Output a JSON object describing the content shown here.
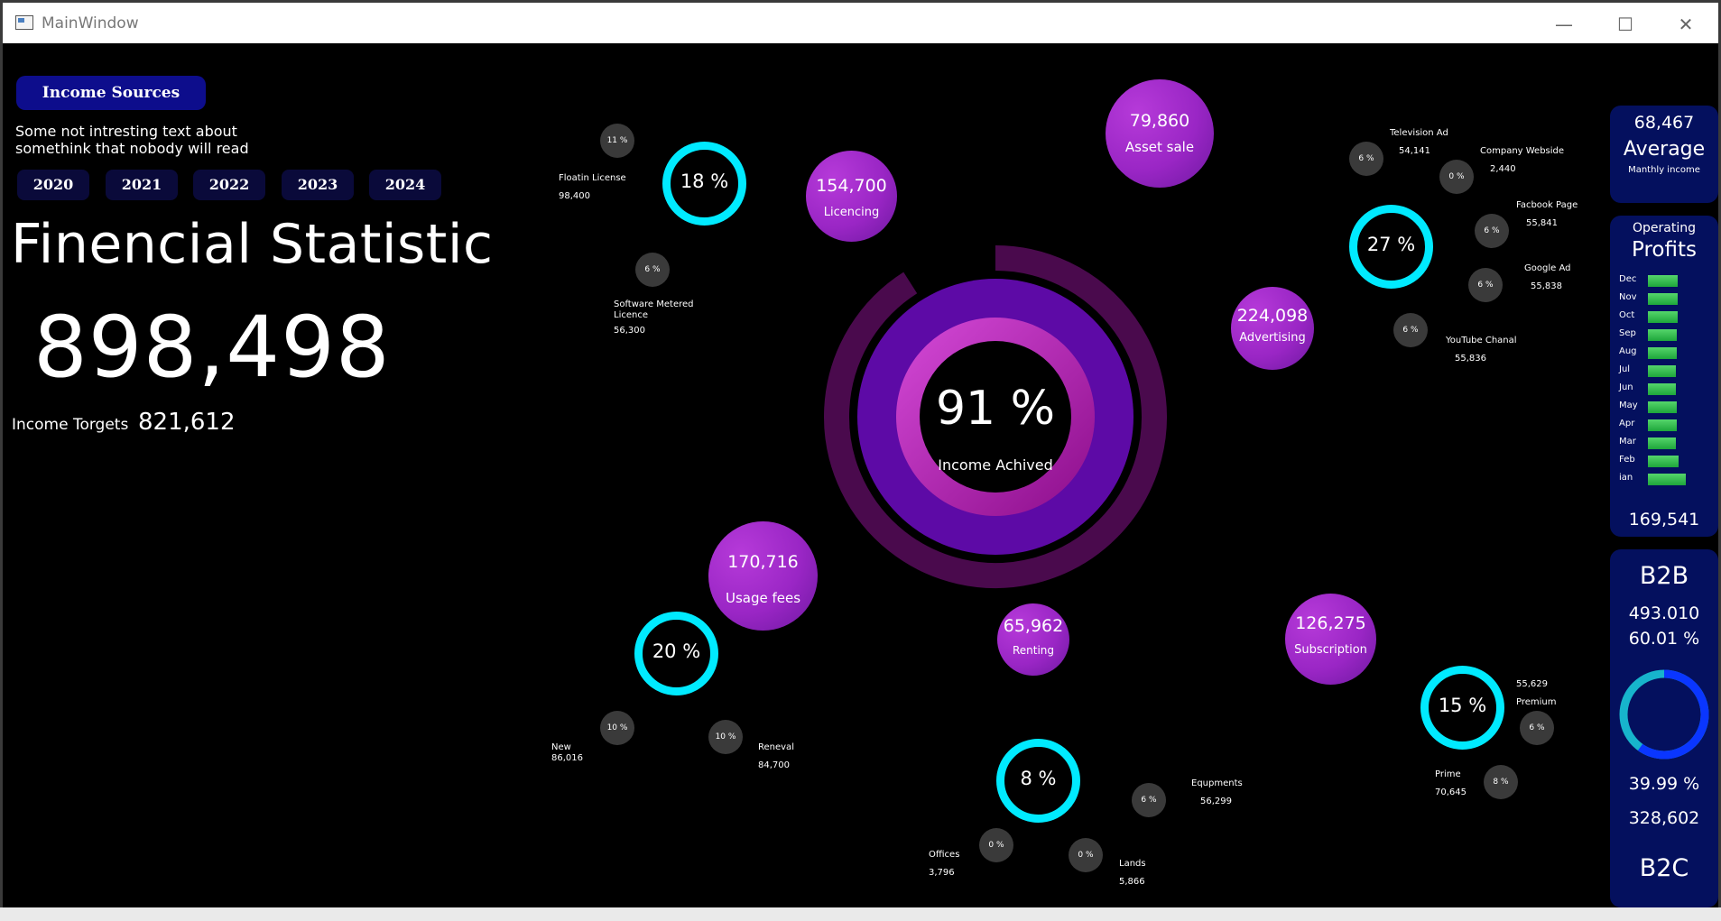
{
  "window": {
    "title": "MainWindow",
    "controls": {
      "minimize": "—",
      "maximize": "☐",
      "close": "✕"
    }
  },
  "sidebar": {
    "sources_button": "Income Sources",
    "description_line1": "Some not intresting text about",
    "description_line2": "somethink  that nobody will read",
    "years": [
      "2020",
      "2021",
      "2022",
      "2023",
      "2024"
    ],
    "title": "Finencial Statistic",
    "total_income": "898,498",
    "target_label": "Income Torgets",
    "target_value": "821,612"
  },
  "center": {
    "percent": "91 %",
    "label": "Income Achived",
    "income_achieved_fraction": 0.91
  },
  "bubbles": {
    "asset_sale": {
      "value": "79,860",
      "label": "Asset sale"
    },
    "licencing": {
      "value": "154,700",
      "label": "Licencing"
    },
    "advertising": {
      "value": "224,098",
      "label": "Advertising"
    },
    "usage_fees": {
      "value": "170,716",
      "label": "Usage fees"
    },
    "renting": {
      "value": "65,962",
      "label": "Renting"
    },
    "subscription": {
      "value": "126,275",
      "label": "Subscription"
    }
  },
  "rings": {
    "licencing": "18  %",
    "advertising": "27  %",
    "usage_fees": "20  %",
    "renting": "8    %",
    "subscription": "15  %"
  },
  "details": {
    "floatin_license": {
      "pct": "11  %",
      "label": "Floatin License",
      "value": "98,400"
    },
    "software_metered": {
      "pct": "6   %",
      "label1": "Software Metered",
      "label2": "Licence",
      "value": "56,300"
    },
    "television_ad": {
      "pct": "6   %",
      "label": "Television Ad",
      "value": "54,141"
    },
    "company_website": {
      "pct": "0   %",
      "label": "Company Webside",
      "value": "2,440"
    },
    "facebook_page": {
      "pct": "6   %",
      "label": "Facbook Page",
      "value": "55,841"
    },
    "google_ad": {
      "pct": "6   %",
      "label": "Google Ad",
      "value": "55,838"
    },
    "youtube_channel": {
      "pct": "6   %",
      "label": "YouTube Chanal",
      "value": "55,836"
    },
    "new": {
      "pct": "10   %",
      "label": "New",
      "value": "86,016"
    },
    "renewal": {
      "pct": "10   %",
      "label": "Reneval",
      "value": "84,700"
    },
    "offices": {
      "pct": "0   %",
      "label": "Offices",
      "value": "3,796"
    },
    "lands": {
      "pct": "0   %",
      "label": "Lands",
      "value": "5,866"
    },
    "equipments": {
      "pct": "6   %",
      "label": "Equpments",
      "value": "56,299"
    },
    "premium": {
      "pct": "6   %",
      "label": "Premium",
      "value": "55,629"
    },
    "prime": {
      "pct": "8   %",
      "label": "Prime",
      "value": "70,645"
    }
  },
  "average_panel": {
    "value": "68,467",
    "title": "Average",
    "subtitle": "Manthly income"
  },
  "profits_panel": {
    "title_small": "Operating",
    "title": "Profits",
    "months": [
      "Dec",
      "Nov",
      "Oct",
      "Sep",
      "Aug",
      "Jul",
      "Jun",
      "May",
      "Apr",
      "Mar",
      "Feb",
      "ian"
    ],
    "bar_levels": [
      0.62,
      0.62,
      0.62,
      0.6,
      0.6,
      0.58,
      0.58,
      0.6,
      0.6,
      0.57,
      0.63,
      0.78
    ],
    "total": "169,541"
  },
  "b2b_panel": {
    "title_top": "B2B",
    "b2b_value": "493.010",
    "b2b_pct": "60.01  %",
    "b2c_pct": "39.99  %",
    "b2c_value": "328,602",
    "title_bottom": "B2C",
    "b2b_fraction": 0.6001
  },
  "colors": {
    "accent_cyan": "#00eaff",
    "bubble_purple": "#9a26c5",
    "panel_navy": "#04105e",
    "button_blue": "#0d0d8c",
    "bar_green": "#2fbf4a"
  }
}
